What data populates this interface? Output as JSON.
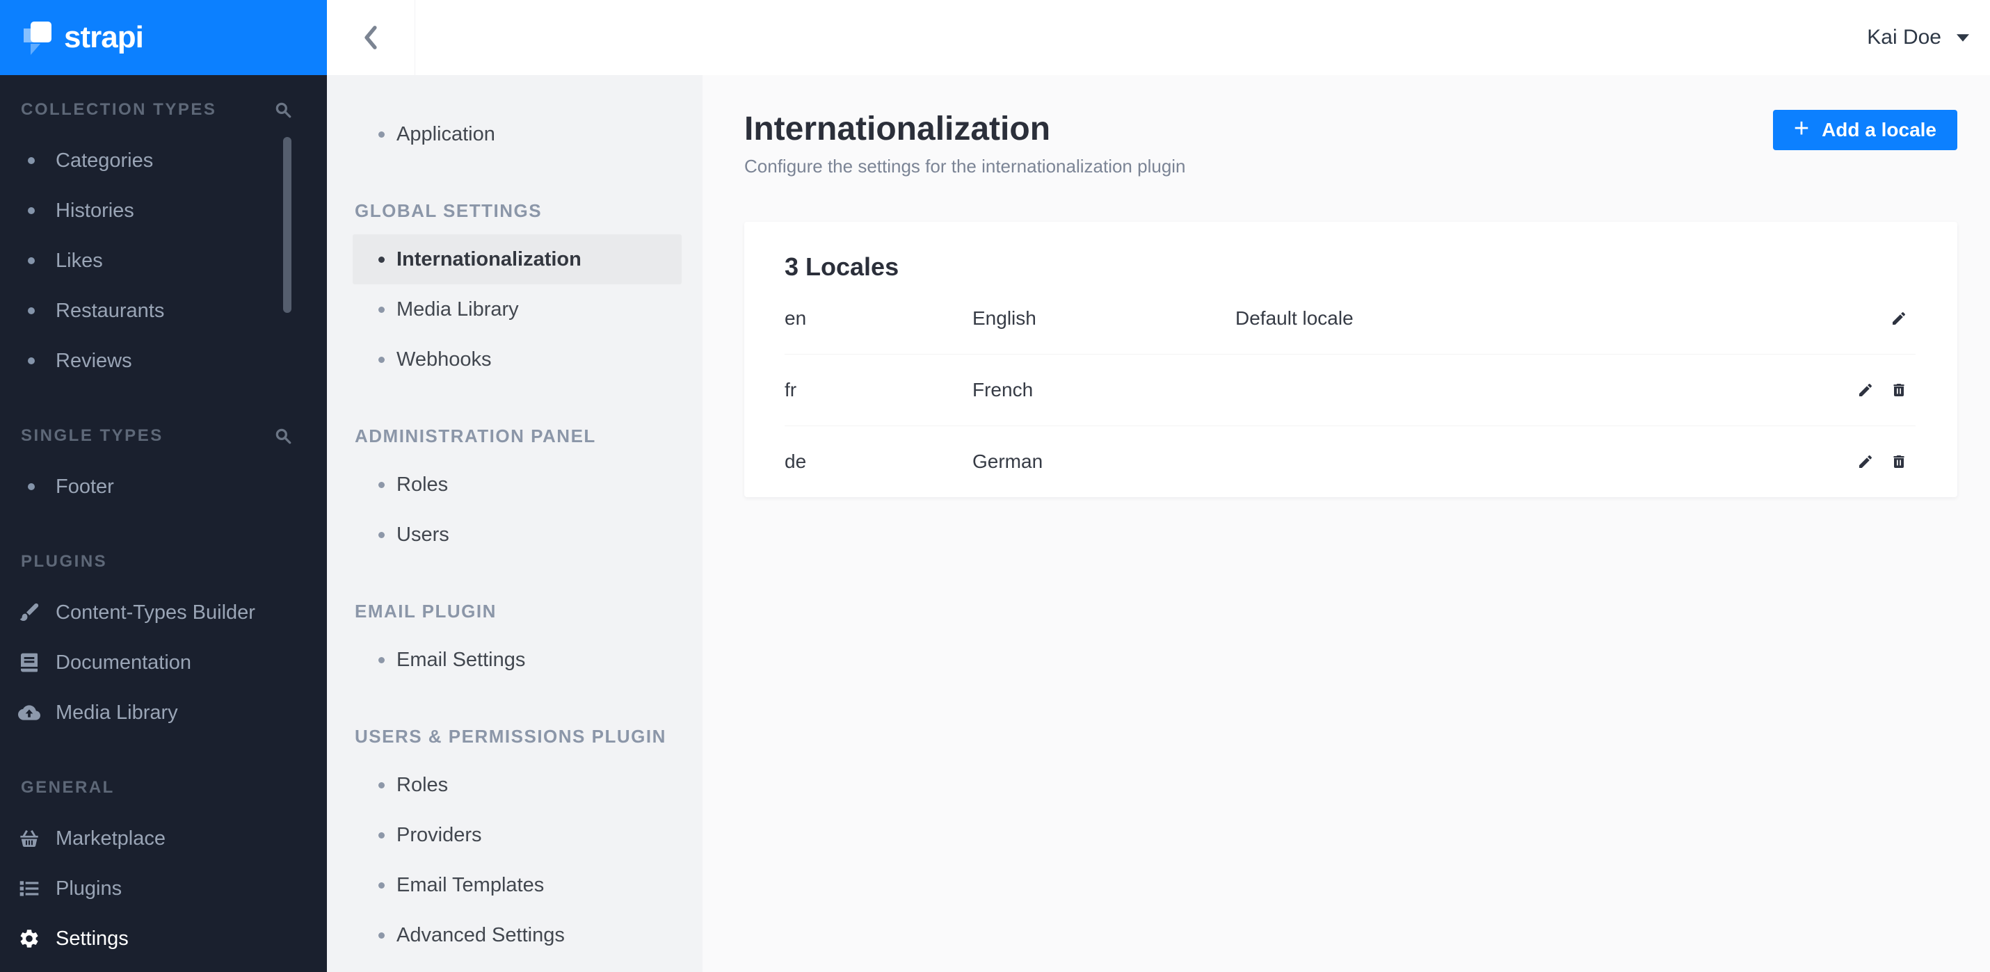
{
  "brand": {
    "name": "strapi",
    "accent_blue": "#0c80ff",
    "menu_dark": "#1a202e"
  },
  "topbar": {
    "user_name": "Kai Doe",
    "back_icon": "chevron-left-icon",
    "user_caret": "caret-down-icon"
  },
  "left_sidebar": {
    "sections": [
      {
        "label": "COLLECTION TYPES",
        "has_search": true,
        "items": [
          {
            "label": "Categories"
          },
          {
            "label": "Histories"
          },
          {
            "label": "Likes"
          },
          {
            "label": "Restaurants"
          },
          {
            "label": "Reviews"
          }
        ]
      },
      {
        "label": "SINGLE TYPES",
        "has_search": true,
        "items": [
          {
            "label": "Footer"
          }
        ]
      },
      {
        "label": "PLUGINS",
        "items": [
          {
            "label": "Content-Types Builder",
            "icon": "paintbrush-icon"
          },
          {
            "label": "Documentation",
            "icon": "book-icon"
          },
          {
            "label": "Media Library",
            "icon": "cloud-upload-icon"
          }
        ]
      },
      {
        "label": "GENERAL",
        "items": [
          {
            "label": "Marketplace",
            "icon": "basket-icon"
          },
          {
            "label": "Plugins",
            "icon": "list-icon"
          },
          {
            "label": "Settings",
            "icon": "gear-icon",
            "active": true
          }
        ]
      }
    ]
  },
  "settings_nav": {
    "top_item": {
      "label": "Application"
    },
    "sections": [
      {
        "label": "GLOBAL SETTINGS",
        "items": [
          {
            "label": "Internationalization",
            "active": true
          },
          {
            "label": "Media Library"
          },
          {
            "label": "Webhooks"
          }
        ]
      },
      {
        "label": "ADMINISTRATION PANEL",
        "items": [
          {
            "label": "Roles"
          },
          {
            "label": "Users"
          }
        ]
      },
      {
        "label": "EMAIL PLUGIN",
        "items": [
          {
            "label": "Email Settings"
          }
        ]
      },
      {
        "label": "USERS & PERMISSIONS PLUGIN",
        "items": [
          {
            "label": "Roles"
          },
          {
            "label": "Providers"
          },
          {
            "label": "Email Templates"
          },
          {
            "label": "Advanced Settings"
          }
        ]
      }
    ]
  },
  "page": {
    "title": "Internationalization",
    "subtitle": "Configure the settings for the internationalization plugin",
    "add_button_label": "Add a locale",
    "add_button_icon": "plus-icon"
  },
  "locales_card": {
    "heading": "3 Locales",
    "rows": [
      {
        "code": "en",
        "name": "English",
        "note": "Default locale",
        "actions": [
          "edit"
        ]
      },
      {
        "code": "fr",
        "name": "French",
        "note": "",
        "actions": [
          "edit",
          "delete"
        ]
      },
      {
        "code": "de",
        "name": "German",
        "note": "",
        "actions": [
          "edit",
          "delete"
        ]
      }
    ]
  }
}
